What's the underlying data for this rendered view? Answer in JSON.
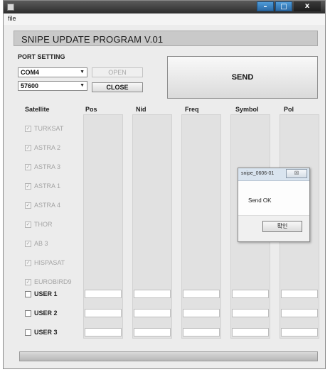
{
  "window": {
    "minimize_glyph": "–",
    "maximize_glyph": "□",
    "close_glyph": "x"
  },
  "menu": {
    "file": "file"
  },
  "header": {
    "title": "SNIPE UPDATE PROGRAM V.01"
  },
  "port_setting": {
    "label": "PORT SETTING",
    "port_value": "COM4",
    "baud_value": "57600",
    "open_label": "OPEN",
    "close_label": "CLOSE",
    "open_enabled": false
  },
  "send": {
    "label": "SEND"
  },
  "columns": {
    "satellite": "Satellite",
    "pos": "Pos",
    "nid": "Nid",
    "freq": "Freq",
    "symbol": "Symbol",
    "pol": "Pol"
  },
  "satellites": [
    {
      "label": "TURKSAT",
      "checked": true
    },
    {
      "label": "ASTRA 2",
      "checked": true
    },
    {
      "label": "ASTRA 3",
      "checked": true
    },
    {
      "label": "ASTRA 1",
      "checked": true
    },
    {
      "label": "ASTRA 4",
      "checked": true
    },
    {
      "label": "THOR",
      "checked": true
    },
    {
      "label": "AB 3",
      "checked": true
    },
    {
      "label": "HISPASAT",
      "checked": true
    },
    {
      "label": "EUROBIRD9",
      "checked": true
    }
  ],
  "users": [
    {
      "label": "USER 1",
      "checked": false
    },
    {
      "label": "USER 2",
      "checked": false
    },
    {
      "label": "USER 3",
      "checked": false
    }
  ],
  "dialog": {
    "title": "snipe_0606-01",
    "close_glyph": "☒",
    "message": "Send OK",
    "ok_label": "확인"
  },
  "progress": {
    "value": 1.0
  }
}
